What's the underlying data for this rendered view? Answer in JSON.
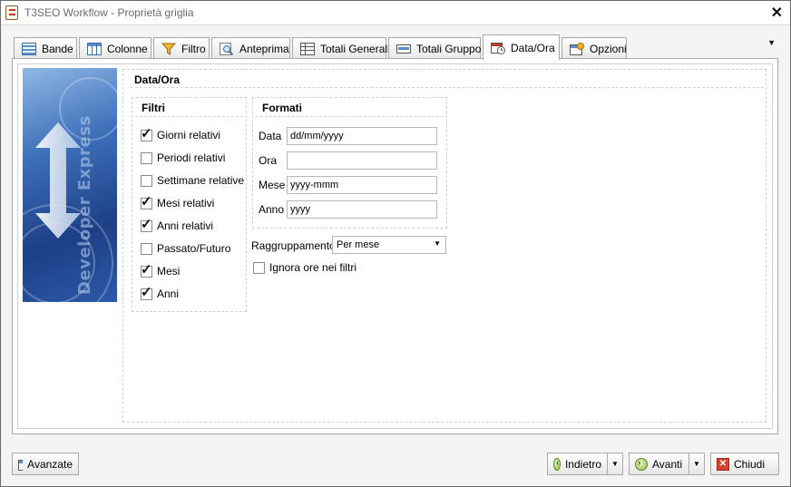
{
  "window": {
    "title": "T3SEO Workflow - Proprietà griglia",
    "close_glyph": "✕"
  },
  "tabs": [
    {
      "label": "Bande",
      "icon": "bands-icon"
    },
    {
      "label": "Colonne",
      "icon": "columns-icon"
    },
    {
      "label": "Filtro",
      "icon": "filter-funnel-icon"
    },
    {
      "label": "Anteprima",
      "icon": "preview-magnifier-icon"
    },
    {
      "label": "Totali Generali",
      "icon": "grand-totals-icon"
    },
    {
      "label": "Totali Gruppo",
      "icon": "group-totals-icon"
    },
    {
      "label": "Data/Ora",
      "icon": "calendar-clock-icon",
      "active": true
    },
    {
      "label": "Opzioni",
      "icon": "options-icon"
    }
  ],
  "tab_menu_glyph": "▼",
  "banner": {
    "text": "Developer Express"
  },
  "page": {
    "group_title": "Data/Ora",
    "filtri": {
      "title": "Filtri",
      "items": [
        {
          "label": "Giorni relativi",
          "checked": true
        },
        {
          "label": "Periodi relativi",
          "checked": false
        },
        {
          "label": "Settimane relative",
          "checked": false
        },
        {
          "label": "Mesi relativi",
          "checked": true
        },
        {
          "label": "Anni relativi",
          "checked": true
        },
        {
          "label": "Passato/Futuro",
          "checked": false
        },
        {
          "label": "Mesi",
          "checked": true
        },
        {
          "label": "Anni",
          "checked": true
        }
      ]
    },
    "formati": {
      "title": "Formati",
      "fields": [
        {
          "label": "Data",
          "value": "dd/mm/yyyy"
        },
        {
          "label": "Ora",
          "value": ""
        },
        {
          "label": "Mese",
          "value": "yyyy-mmm"
        },
        {
          "label": "Anno",
          "value": "yyyy"
        }
      ]
    },
    "raggruppamento": {
      "label": "Raggruppamento",
      "value": "Per mese"
    },
    "ignora": {
      "label": "Ignora ore nei filtri",
      "checked": false
    }
  },
  "footer": {
    "avanzate": "Avanzate",
    "indietro": "Indietro",
    "avanti": "Avanti",
    "chiudi": "Chiudi",
    "split_glyph": "▼"
  }
}
